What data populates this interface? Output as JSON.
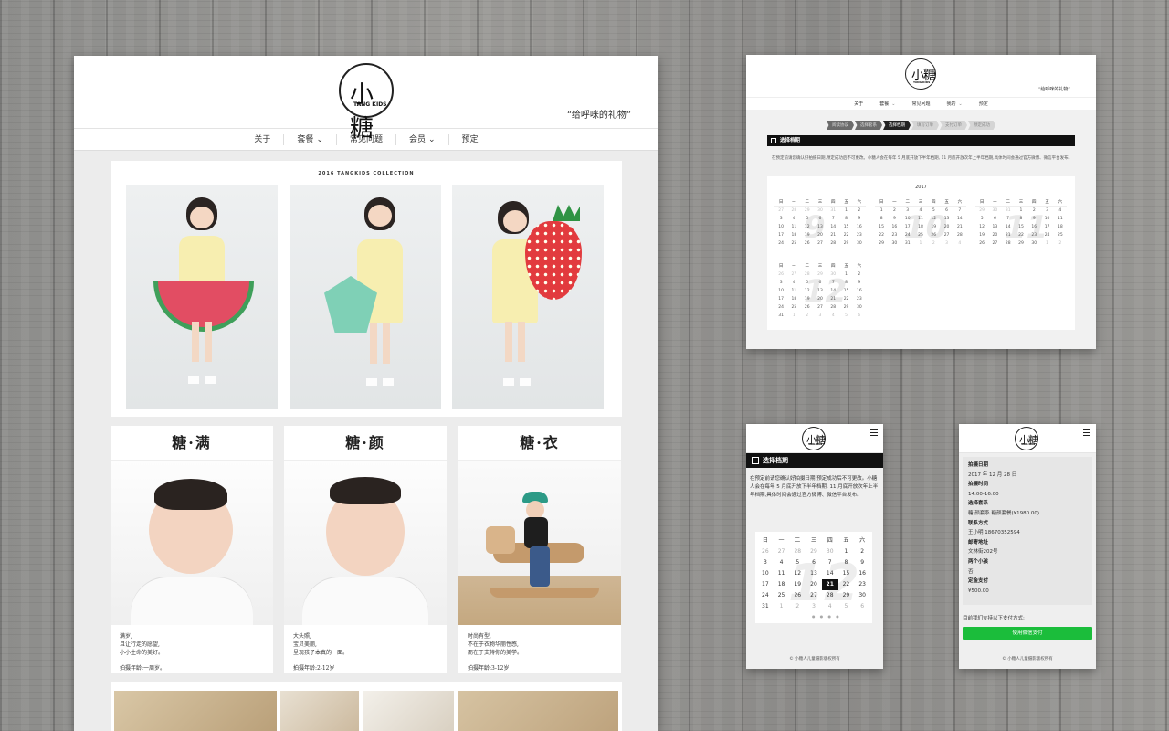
{
  "brand": {
    "logo_big": "小糖",
    "logo_small": "TANG KIDS",
    "tagline": "“给呼咪的礼物”"
  },
  "main": {
    "nav": [
      {
        "label": "关于"
      },
      {
        "label": "套餐",
        "caret": "⌄"
      },
      {
        "label": "常见问题"
      },
      {
        "label": "会员",
        "caret": "⌄"
      },
      {
        "label": "预定"
      }
    ],
    "collection_title": "2016 TANGKIDS COLLECTION",
    "cards": [
      {
        "title": "糖·满",
        "lines": [
          "满岁,",
          "且让行走的愿望,",
          "小小生命的美好。"
        ],
        "age": "拍摄年龄:一周岁。"
      },
      {
        "title": "糖·颜",
        "lines": [
          "大头照,",
          "宝贝美丽,",
          "呈现孩子本真的一面。"
        ],
        "age": "拍摄年龄:2-12岁"
      },
      {
        "title": "糖·衣",
        "lines": [
          "时尚有型,",
          "不在于衣物华丽性感,",
          "而在于支持你的美学。"
        ],
        "age": "拍摄年龄:3-12岁"
      }
    ]
  },
  "cal": {
    "nav": [
      {
        "label": "关于"
      },
      {
        "label": "套餐",
        "caret": "⌄"
      },
      {
        "label": "常见问题"
      },
      {
        "label": "我的",
        "caret": "⌄"
      },
      {
        "label": "预定"
      }
    ],
    "steps": [
      "阅读协议",
      "选择套系",
      "选择档期",
      "填写订单",
      "支付订单",
      "预定成功"
    ],
    "active_step": 2,
    "title": "选择档期",
    "notice": "在预定前请您确认好拍摄日期,预定成功后不可更改。小糖人会在每年 5 月底开放下半年档期, 11 月底开放次年上半年档期,具体时间会通过官方微博、微信平台发布。",
    "year": "2017",
    "weekdays": [
      "日",
      "一",
      "二",
      "三",
      "四",
      "五",
      "六"
    ],
    "months": [
      {
        "num": "9",
        "days": [
          "27",
          "28",
          "29",
          "30",
          "31",
          "1",
          "2",
          "3",
          "4",
          "5",
          "6",
          "7",
          "8",
          "9",
          "10",
          "11",
          "12",
          "13",
          "14",
          "15",
          "16",
          "17",
          "18",
          "19",
          "20",
          "21",
          "22",
          "23",
          "24",
          "25",
          "26",
          "27",
          "28",
          "29",
          "30"
        ]
      },
      {
        "num": "10",
        "days": [
          "1",
          "2",
          "3",
          "4",
          "5",
          "6",
          "7",
          "8",
          "9",
          "10",
          "11",
          "12",
          "13",
          "14",
          "15",
          "16",
          "17",
          "18",
          "19",
          "20",
          "21",
          "22",
          "23",
          "24",
          "25",
          "26",
          "27",
          "28",
          "29",
          "30",
          "31",
          "1",
          "2",
          "3",
          "4"
        ]
      },
      {
        "num": "11",
        "days": [
          "29",
          "30",
          "31",
          "1",
          "2",
          "3",
          "4",
          "5",
          "6",
          "7",
          "8",
          "9",
          "10",
          "11",
          "12",
          "13",
          "14",
          "15",
          "16",
          "17",
          "18",
          "19",
          "20",
          "21",
          "22",
          "23",
          "24",
          "25",
          "26",
          "27",
          "28",
          "29",
          "30",
          "1",
          "2"
        ]
      },
      {
        "num": "12",
        "days": [
          "26",
          "27",
          "28",
          "29",
          "30",
          "1",
          "2",
          "3",
          "4",
          "5",
          "6",
          "7",
          "8",
          "9",
          "10",
          "11",
          "12",
          "13",
          "14",
          "15",
          "16",
          "17",
          "18",
          "19",
          "20",
          "21",
          "22",
          "23",
          "24",
          "25",
          "26",
          "27",
          "28",
          "29",
          "30",
          "31",
          "1",
          "2",
          "3",
          "4",
          "5",
          "6"
        ]
      }
    ]
  },
  "mob1": {
    "title": "选择档期",
    "notice": "在预定前请您确认好拍摄日期,预定成功后不可更改。小糖人会在每年 5 月底开放下半年档期, 11 月底开放次年上半年档期,具体时间会通过官方微博、微信平台发布。",
    "weekdays": [
      "日",
      "一",
      "二",
      "三",
      "四",
      "五",
      "六"
    ],
    "month_num": "12",
    "days": [
      "26",
      "27",
      "28",
      "29",
      "30",
      "1",
      "2",
      "3",
      "4",
      "5",
      "6",
      "7",
      "8",
      "9",
      "10",
      "11",
      "12",
      "13",
      "14",
      "15",
      "16",
      "17",
      "18",
      "19",
      "20",
      "21",
      "22",
      "23",
      "24",
      "25",
      "26",
      "27",
      "28",
      "29",
      "30",
      "31",
      "1",
      "2",
      "3",
      "4",
      "5",
      "6"
    ],
    "selected_day": "21",
    "dots": "● ● ● ●",
    "footer": "© 小糖人儿童摄影版权所有"
  },
  "mob2": {
    "rows": [
      {
        "label": "拍摄日期",
        "value": "2017 年 12 月 28 日"
      },
      {
        "label": "拍摄时间",
        "value": "14:00-16:00"
      },
      {
        "label": "选择套系",
        "value": "糖·颜套系 糖颜套餐(¥1980.00)"
      },
      {
        "label": "联系方式",
        "value": "王小明 18670352594"
      },
      {
        "label": "邮寄地址",
        "value": "文林街202号"
      },
      {
        "label": "两个小孩",
        "value": "否"
      },
      {
        "label": "定金支付",
        "value": "¥500.00"
      }
    ],
    "pay_note": "目前我们支持以下支付方式:",
    "pay_button": "使用微信支付",
    "footer": "© 小糖人儿童摄影版权所有"
  },
  "colors": {
    "wechat_green": "#1bbd3b",
    "dark_bar": "#111111"
  }
}
